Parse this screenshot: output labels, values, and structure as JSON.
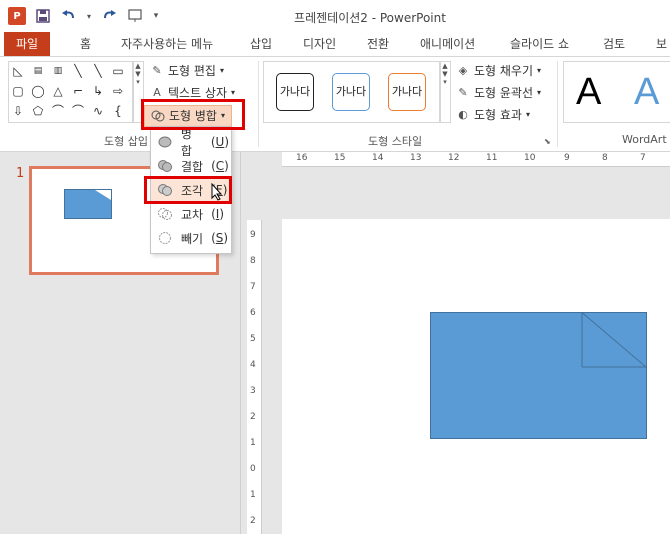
{
  "window": {
    "title": "프레젠테이션2 - PowerPoint",
    "app_logo": "P"
  },
  "qat": {
    "icons": [
      "powerpoint-logo-icon",
      "save-icon",
      "undo-icon",
      "redo-icon",
      "presentation-from-start-icon",
      "customize-qat-icon"
    ]
  },
  "tabs": [
    "파일",
    "홈",
    "자주사용하는 메뉴",
    "삽입",
    "디자인",
    "전환",
    "애니메이션",
    "슬라이드 쇼",
    "검토",
    "보"
  ],
  "ribbon": {
    "insert_shapes": {
      "label": "도형 삽입",
      "edit_shape": "도형 편집",
      "text_box": "텍스트 상자",
      "merge_shapes": "도형 병합"
    },
    "shape_styles": {
      "label": "도형 스타일",
      "swatch_text": "가나다",
      "fill": "도형 채우기",
      "outline": "도형 윤곽선",
      "effects": "도형 효과"
    },
    "wordart": {
      "label": "WordArt",
      "letter": "A"
    }
  },
  "merge_menu": {
    "items": [
      {
        "label": "병합",
        "shortcut": "U"
      },
      {
        "label": "결합",
        "shortcut": "C"
      },
      {
        "label": "조각",
        "shortcut": "F"
      },
      {
        "label": "교차",
        "shortcut": "I"
      },
      {
        "label": "빼기",
        "shortcut": "S"
      }
    ],
    "highlighted": "조각"
  },
  "slides": {
    "number": "1"
  },
  "ruler": {
    "horizontal_labels": [
      "16",
      "15",
      "14",
      "13",
      "12",
      "11",
      "10",
      "9",
      "8",
      "7"
    ],
    "vertical_labels": [
      "9",
      "8",
      "7",
      "6",
      "5",
      "4",
      "3",
      "2",
      "1",
      "0",
      "1",
      "2"
    ]
  },
  "colors": {
    "accent": "#c43e1c",
    "shape_fill": "#5b9bd5",
    "highlight_red": "#e00000",
    "thumb_border": "#e07a5f"
  }
}
